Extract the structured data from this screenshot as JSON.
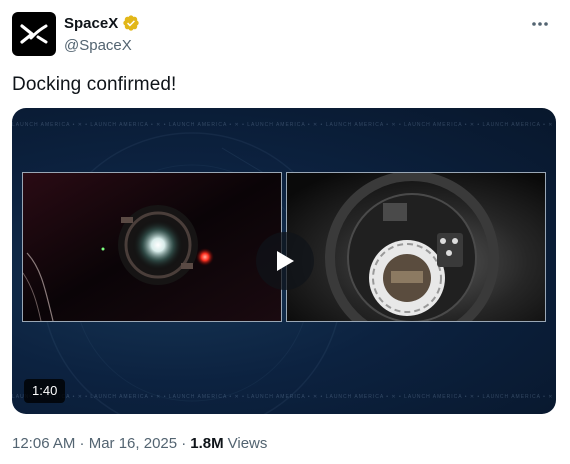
{
  "author": {
    "name": "SpaceX",
    "handle": "@SpaceX",
    "avatar_icon": "spacex-x-logo",
    "verified_color": "#e2b719"
  },
  "tweet": {
    "text": "Docking confirmed!"
  },
  "video": {
    "duration": "1:40",
    "ticker_text": "LAUNCH AMERICA • ✕ • LAUNCH AMERICA • ✕ • LAUNCH AMERICA • ✕ • LAUNCH AMERICA • ✕ • LAUNCH AMERICA • ✕ • LAUNCH AMERICA • ✕ • LAUNCH AMERICA • ✕ • LAUNCH AMERICA • ✕ • LAUNCH AMERICA • ✕ • LAUNCH AMERICA"
  },
  "footer": {
    "timestamp": "12:06 AM · Mar 16, 2025 ·",
    "views_count": "1.8M",
    "views_label": "Views"
  },
  "colors": {
    "text": "#0f1419",
    "secondary": "#536471",
    "video_bg": "#0c2240"
  }
}
